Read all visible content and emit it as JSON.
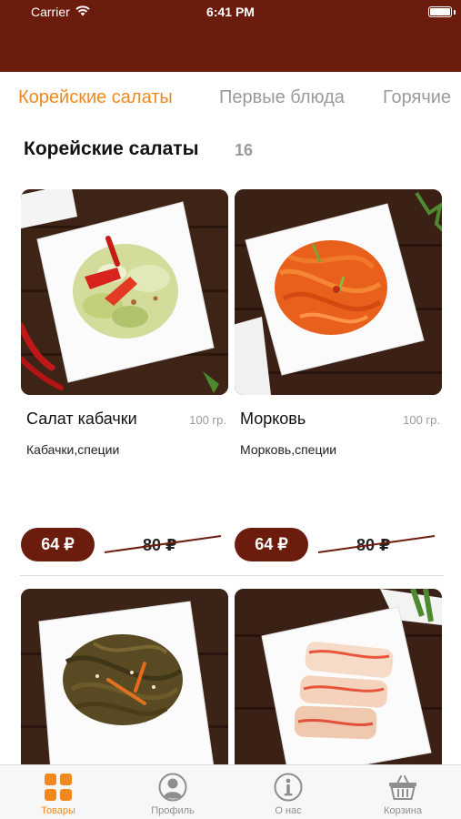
{
  "status_bar": {
    "carrier": "Carrier",
    "time": "6:41 PM"
  },
  "colors": {
    "brand": "#6b1c0c",
    "accent": "#f0881e",
    "muted": "#9a9a9a"
  },
  "tabs": [
    {
      "label": "Корейские салаты",
      "active": true
    },
    {
      "label": "Первые блюда",
      "active": false
    },
    {
      "label": "Горячие",
      "active": false
    }
  ],
  "section": {
    "title": "Корейские салаты",
    "count": "16"
  },
  "products": [
    {
      "name": "Салат кабачки",
      "weight": "100 гр.",
      "description": "Кабачки,специи",
      "price": "64 ₽",
      "old_price": "80 ₽",
      "image": "zucchini-salad"
    },
    {
      "name": "Морковь",
      "weight": "100 гр.",
      "description": "Морковь,специи",
      "price": "64 ₽",
      "old_price": "80 ₽",
      "image": "carrot-salad"
    },
    {
      "image": "seaweed-salad"
    },
    {
      "image": "kimchi-salad"
    }
  ],
  "bottom_nav": [
    {
      "label": "Товары",
      "icon": "grid-icon",
      "active": true
    },
    {
      "label": "Профиль",
      "icon": "profile-icon",
      "active": false
    },
    {
      "label": "О нас",
      "icon": "info-icon",
      "active": false
    },
    {
      "label": "Корзина",
      "icon": "basket-icon",
      "active": false
    }
  ]
}
